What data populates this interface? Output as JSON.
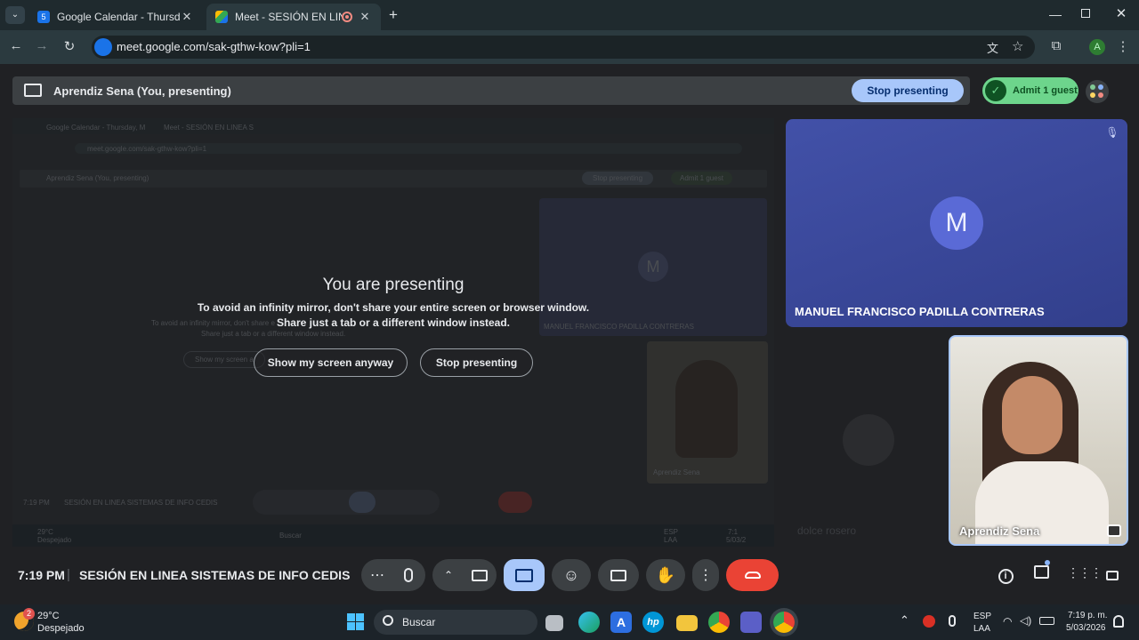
{
  "browser": {
    "tabs": [
      {
        "title": "Google Calendar - Thursday, M",
        "favicon_color": "#1a73e8"
      },
      {
        "title": "Meet - SESIÓN EN LINEA SI",
        "favicon_color": "#00832d"
      }
    ],
    "url": "meet.google.com/sak-gthw-kow?pli=1",
    "profile_initial": "A"
  },
  "present_bar": {
    "text": "Aprendiz Sena (You, presenting)",
    "stop_label": "Stop presenting",
    "admit_label": "Admit 1 guest"
  },
  "warning": {
    "title": "You are presenting",
    "line1": "To avoid an infinity mirror, don't share your entire screen or browser window.",
    "line2": "Share just a tab or a different window instead.",
    "show_anyway": "Show my screen anyway",
    "stop": "Stop presenting"
  },
  "mirror": {
    "tab1": "Google Calendar - Thursday, M",
    "tab2": "Meet - SESIÓN EN LINEA S",
    "url": "meet.google.com/sak-gthw-kow?pli=1",
    "present_text": "Aprendiz Sena (You, presenting)",
    "stop": "Stop presenting",
    "admit": "Admit 1 guest",
    "warn1": "To avoid an infinity mirror, don't share e",
    "warn2": "Share just a tab or a different window instead.",
    "show": "Show my screen a",
    "participant": "MANUEL FRANCISCO PADILLA CONTRERAS",
    "avatar": "M",
    "self_name": "Aprendiz Sena",
    "time": "7:19 PM",
    "meeting": "SESIÓN EN LINEA SISTEMAS DE INFO CEDIS",
    "weather_temp": "29°C",
    "weather_desc": "Despejado",
    "search": "Buscar",
    "lang": "ESP",
    "lang2": "LAA",
    "clock": "7:1",
    "date": "5/03/2"
  },
  "participants": {
    "main_name": "MANUEL FRANCISCO PADILLA CONTRERAS",
    "main_avatar": "M",
    "self_name": "Aprendiz Sena",
    "hidden_name": "dolce rosero"
  },
  "footer": {
    "time": "7:19 PM",
    "separator": "|",
    "meeting_name": "SESIÓN EN LINEA SISTEMAS DE INFO CEDIS"
  },
  "taskbar": {
    "weather_badge": "2",
    "temp": "29°C",
    "weather": "Despejado",
    "search": "Buscar",
    "lang1": "ESP",
    "lang2": "LAA",
    "time": "7:19 p. m.",
    "date": "5/03/2026"
  },
  "colors": {
    "accent_blue": "#a8c7fa",
    "end_call_red": "#ea4335",
    "admit_green": "#6dd58c",
    "tile_blue": "#3b4a9a"
  }
}
